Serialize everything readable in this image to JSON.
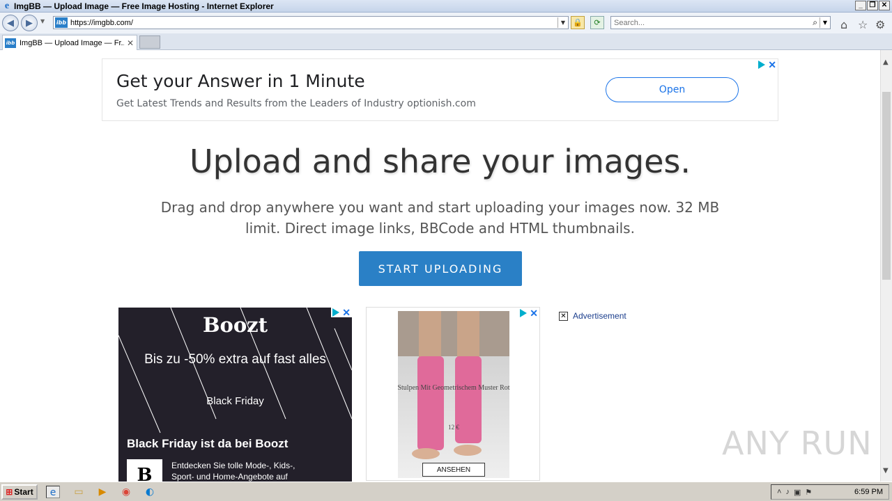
{
  "window": {
    "title": "ImgBB — Upload Image — Free Image Hosting - Internet Explorer",
    "controls": [
      "_",
      "❐",
      "✕"
    ]
  },
  "addressbar": {
    "url": "https://imgbb.com/",
    "favicon_text": "ibb",
    "search_placeholder": "Search..."
  },
  "tabs": [
    {
      "label": "ImgBB — Upload Image — Fr...",
      "favicon_text": "ibb"
    }
  ],
  "ad_top": {
    "headline": "Get your Answer in 1 Minute",
    "subline": "Get Latest Trends and Results from the Leaders of Industry optionish.com",
    "button": "Open"
  },
  "hero": {
    "title": "Upload and share your images.",
    "subtitle": "Drag and drop anywhere you want and start uploading your images now. 32 MB limit. Direct image links, BBCode and HTML thumbnails.",
    "button": "START UPLOADING"
  },
  "ad_boozt": {
    "logo": "Boozt",
    "line1": "Bis zu -50% extra auf fast alles",
    "line2": "Black Friday",
    "headline": "Black Friday ist da bei Boozt",
    "brand_letter": "B",
    "body": "Entdecken Sie tolle Mode-, Kids-, Sport- und Home-Angebote auf"
  },
  "ad_sock": {
    "caption": "Stulpen Mit Geometrischem Muster Rot",
    "price": "12 €",
    "button": "ANSEHEN"
  },
  "advertisement_label": "Advertisement",
  "watermark": "ANY RUN",
  "taskbar": {
    "start": "Start",
    "clock": "6:59 PM"
  },
  "colors": {
    "accent": "#2a80c6",
    "ad_blue": "#1a73e8",
    "boozt_bg": "#23202a",
    "sock_pink": "#e06a9a"
  }
}
